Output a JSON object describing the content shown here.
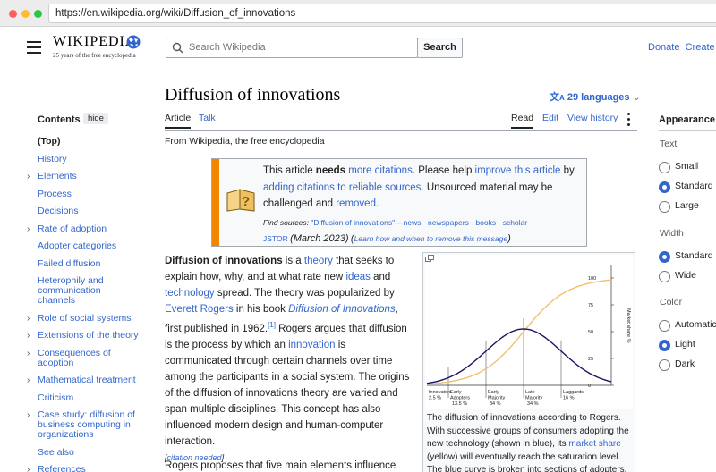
{
  "browser": {
    "url": "https://en.wikipedia.org/wiki/Diffusion_of_innovations",
    "dot_colors": [
      "#ff5f57",
      "#febc2e",
      "#28c840"
    ]
  },
  "header": {
    "logo_word": "WIKIPEDIA",
    "logo_tagline": "25 years of the free encyclopedia",
    "search_placeholder": "Search Wikipedia",
    "search_button": "Search",
    "donate": "Donate",
    "create_account": "Create ac"
  },
  "toc": {
    "title": "Contents",
    "hide": "hide",
    "items": [
      {
        "label": "(Top)",
        "expandable": false,
        "bold": true
      },
      {
        "label": "History",
        "expandable": false
      },
      {
        "label": "Elements",
        "expandable": true
      },
      {
        "label": "Process",
        "expandable": false
      },
      {
        "label": "Decisions",
        "expandable": false
      },
      {
        "label": "Rate of adoption",
        "expandable": true
      },
      {
        "label": "Adopter categories",
        "expandable": false
      },
      {
        "label": "Failed diffusion",
        "expandable": false
      },
      {
        "label": "Heterophily and communication channels",
        "expandable": false
      },
      {
        "label": "Role of social systems",
        "expandable": true
      },
      {
        "label": "Extensions of the theory",
        "expandable": true
      },
      {
        "label": "Consequences of adoption",
        "expandable": true
      },
      {
        "label": "Mathematical treatment",
        "expandable": true
      },
      {
        "label": "Criticism",
        "expandable": false
      },
      {
        "label": "Case study: diffusion of business computing in organizations",
        "expandable": true
      },
      {
        "label": "See also",
        "expandable": false
      },
      {
        "label": "References",
        "expandable": true
      }
    ]
  },
  "article": {
    "title": "Diffusion of innovations",
    "languages": "29 languages",
    "tab_article": "Article",
    "tab_talk": "Talk",
    "tab_read": "Read",
    "tab_edit": "Edit",
    "tab_history": "View history",
    "from": "From Wikipedia, the free encyclopedia"
  },
  "notice": {
    "t1": "This article ",
    "t2": "needs",
    "t3": "more citations",
    "t4": ". Please help ",
    "t5": "improve this article",
    "t6": " by ",
    "t7": "adding citations to reliable sources",
    "t8": ". Unsourced material may be challenged and ",
    "t9": "removed",
    "t10": ".",
    "find": "Find sources:",
    "q": "\"Diffusion of innovations\"",
    "dash": " – ",
    "news": "news",
    "newspapers": "newspapers",
    "books": "books",
    "scholar": "scholar",
    "jstor": "JSTOR",
    "date": "(March 2023)",
    "learn": "Learn how and when to remove this message"
  },
  "body": {
    "p1_a": "Diffusion of innovations",
    "p1_b": " is a ",
    "p1_c": "theory",
    "p1_d": " that seeks to explain how, why, and at what rate new ",
    "p1_e": "ideas",
    "p1_f": " and ",
    "p1_g": "technology",
    "p1_h": " spread. The theory was popularized by ",
    "p1_i": "Everett Rogers",
    "p1_j": " in his book ",
    "p1_k": "Diffusion of Innovations",
    "p1_l": ", first published in 1962.",
    "p1_ref": "[1]",
    "p1_m": " Rogers argues that diffusion is the process by which an ",
    "p1_n": "innovation",
    "p1_o": " is communicated through certain channels over time among the participants in a social system. The origins of the diffusion of innovations theory are varied and span multiple disciplines. This concept has also influenced modern design and human-computer interaction.",
    "citation": "[citation needed]",
    "citation_link": "citation needed",
    "p2": "Rogers proposes that five main elements influence the"
  },
  "figure": {
    "caption_a": "The diffusion of innovations according to Rogers. With successive groups of consumers adopting the new technology (shown in blue), its ",
    "caption_link": "market share",
    "caption_b": " (yellow) will eventually reach the saturation level. The blue curve is broken into sections of adopters."
  },
  "chart_data": {
    "type": "line",
    "ylabel": "Market share %",
    "yticks": [
      0,
      25,
      50,
      75,
      100
    ],
    "ylim": [
      0,
      100
    ],
    "categories": [
      {
        "name": "Innovators",
        "share": "2.5 %"
      },
      {
        "name": "Early Adopters",
        "share": "13.5 %"
      },
      {
        "name": "Early Majority",
        "share": "34 %"
      },
      {
        "name": "Late Majority",
        "share": "34 %"
      },
      {
        "name": "Laggards",
        "share": "16 %"
      }
    ],
    "series": [
      {
        "color": "#1b1464",
        "shape": "normal adoption curve"
      },
      {
        "color": "#f0c070",
        "shape": "cumulative market share to 100"
      }
    ]
  },
  "appearance": {
    "title": "Appearance",
    "text_head": "Text",
    "text_opts": [
      "Small",
      "Standard",
      "Large"
    ],
    "width_head": "Width",
    "width_opts": [
      "Standard",
      "Wide"
    ],
    "color_head": "Color",
    "color_opts": [
      "Automatic",
      "Light",
      "Dark"
    ]
  }
}
